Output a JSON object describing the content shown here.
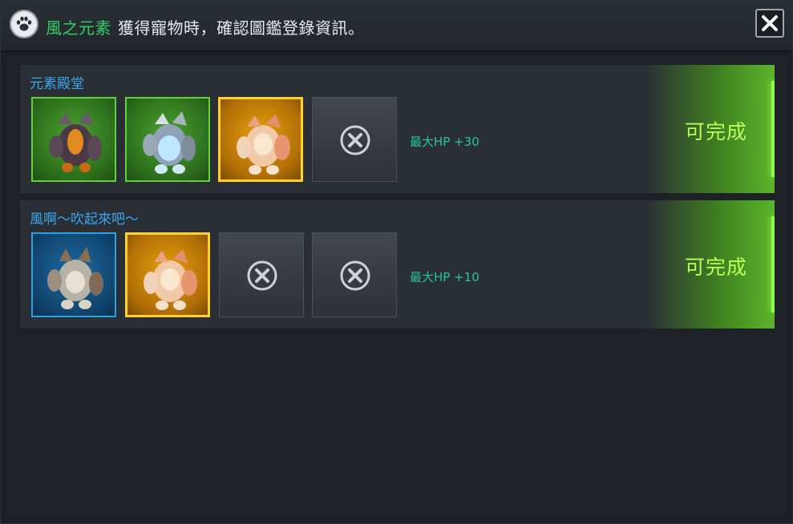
{
  "header": {
    "title": "風之元素",
    "message": "獲得寵物時，確認圖鑑登錄資訊。",
    "icon": "paw-icon",
    "close_icon": "close-icon"
  },
  "collections": [
    {
      "title": "元素殿堂",
      "bonus": "最大HP +30",
      "status": "可完成",
      "slots": [
        {
          "kind": "pet",
          "frame": "green",
          "icon": "dark-rock-golem-icon"
        },
        {
          "kind": "pet",
          "frame": "green",
          "icon": "ice-golem-icon"
        },
        {
          "kind": "pet",
          "frame": "gold",
          "icon": "flame-golem-icon"
        },
        {
          "kind": "empty",
          "icon": "empty-slot-icon"
        }
      ]
    },
    {
      "title": "風啊～吹起來吧～",
      "bonus": "最大HP +10",
      "status": "可完成",
      "slots": [
        {
          "kind": "pet",
          "frame": "blue",
          "icon": "stone-golem-icon"
        },
        {
          "kind": "pet",
          "frame": "gold",
          "icon": "flame-golem-icon"
        },
        {
          "kind": "empty",
          "icon": "empty-slot-icon"
        },
        {
          "kind": "empty",
          "icon": "empty-slot-icon"
        }
      ]
    }
  ],
  "colors": {
    "title_green": "#33d06a",
    "row_title_blue": "#3aa7ef",
    "bonus_teal": "#27c69a",
    "complete_lime": "#b9ff57"
  }
}
